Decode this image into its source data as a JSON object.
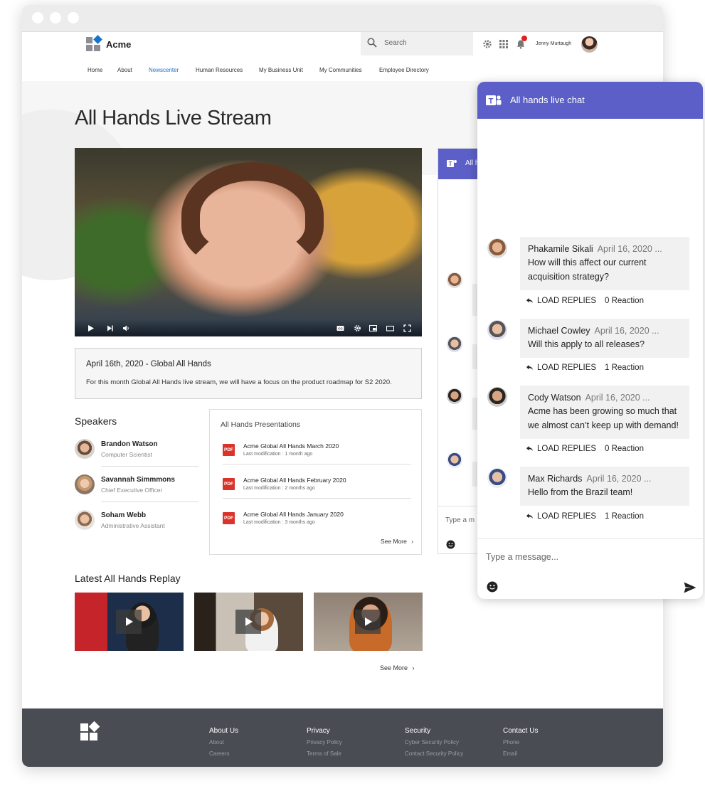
{
  "header": {
    "brand": "Acme",
    "search_placeholder": "Search",
    "user_name": "Jenny Murtaugh"
  },
  "nav": {
    "items": [
      {
        "label": "Home"
      },
      {
        "label": "About"
      },
      {
        "label": "Newscenter",
        "active": true
      },
      {
        "label": "Human Resources"
      },
      {
        "label": "My Business Unit"
      },
      {
        "label": "My Communities"
      },
      {
        "label": "Employee Directory"
      }
    ]
  },
  "page": {
    "title": "All Hands Live Stream"
  },
  "event": {
    "title": "April 16th, 2020 -  Global All Hands",
    "description": "For this month Global All Hands live stream, we will have a focus on the product roadmap for S2 2020."
  },
  "speakers": {
    "heading": "Speakers",
    "items": [
      {
        "name": "Brandon Watson",
        "role": "Computer Scientist"
      },
      {
        "name": "Savannah Simmmons",
        "role": "Chief Executive Officer"
      },
      {
        "name": "Soham Webb",
        "role": "Administrative Assistant"
      }
    ]
  },
  "presentations": {
    "heading": "All Hands Presentations",
    "items": [
      {
        "file": "Acme Global All Hands March 2020",
        "modified": "Last modification : 1 month ago"
      },
      {
        "file": "Acme Global All Hands February 2020",
        "modified": "Last modification : 2 months ago"
      },
      {
        "file": "Acme Global All Hands January 2020",
        "modified": "Last modification : 3 months ago"
      }
    ],
    "pdf_label": "PDF",
    "see_more": "See More"
  },
  "replays": {
    "heading": "Latest All Hands Replay",
    "see_more": "See More"
  },
  "inner_chat": {
    "title": "All h",
    "input_placeholder": "Type a m"
  },
  "chat": {
    "title": "All hands live chat",
    "messages": [
      {
        "author": "Phakamile Sikali",
        "date": "April 16, 2020 ...",
        "text": "How will this affect our current acquisition strategy?",
        "load": "LOAD REPLIES",
        "reaction": "0 Reaction"
      },
      {
        "author": "Michael Cowley",
        "date": "April 16, 2020 ...",
        "text": "Will this apply to all releases?",
        "load": "LOAD REPLIES",
        "reaction": "1 Reaction"
      },
      {
        "author": "Cody Watson",
        "date": "April 16, 2020 ...",
        "text": "Acme has been growing so much that we almost can’t keep up with demand!",
        "load": "LOAD REPLIES",
        "reaction": "0 Reaction"
      },
      {
        "author": "Max Richards",
        "date": "April 16, 2020 ...",
        "text": "Hello from the Brazil team!",
        "load": "LOAD REPLIES",
        "reaction": "1 Reaction"
      }
    ],
    "input_placeholder": "Type a message..."
  },
  "footer": {
    "columns": [
      {
        "heading": "About Us",
        "links": [
          "About",
          "Careers"
        ]
      },
      {
        "heading": "Privacy",
        "links": [
          "Privacy Policy",
          "Terms of Sale"
        ]
      },
      {
        "heading": "Security",
        "links": [
          "Cyber Security Policy",
          "Contact Security Policy"
        ]
      },
      {
        "heading": "Contact Us",
        "links": [
          "Phone",
          "Email"
        ]
      }
    ]
  },
  "colors": {
    "teams_purple": "#5b5fc7",
    "nav_active": "#1a73c8",
    "footer_bg": "#4a4c54",
    "pdf_red": "#d9342b"
  }
}
